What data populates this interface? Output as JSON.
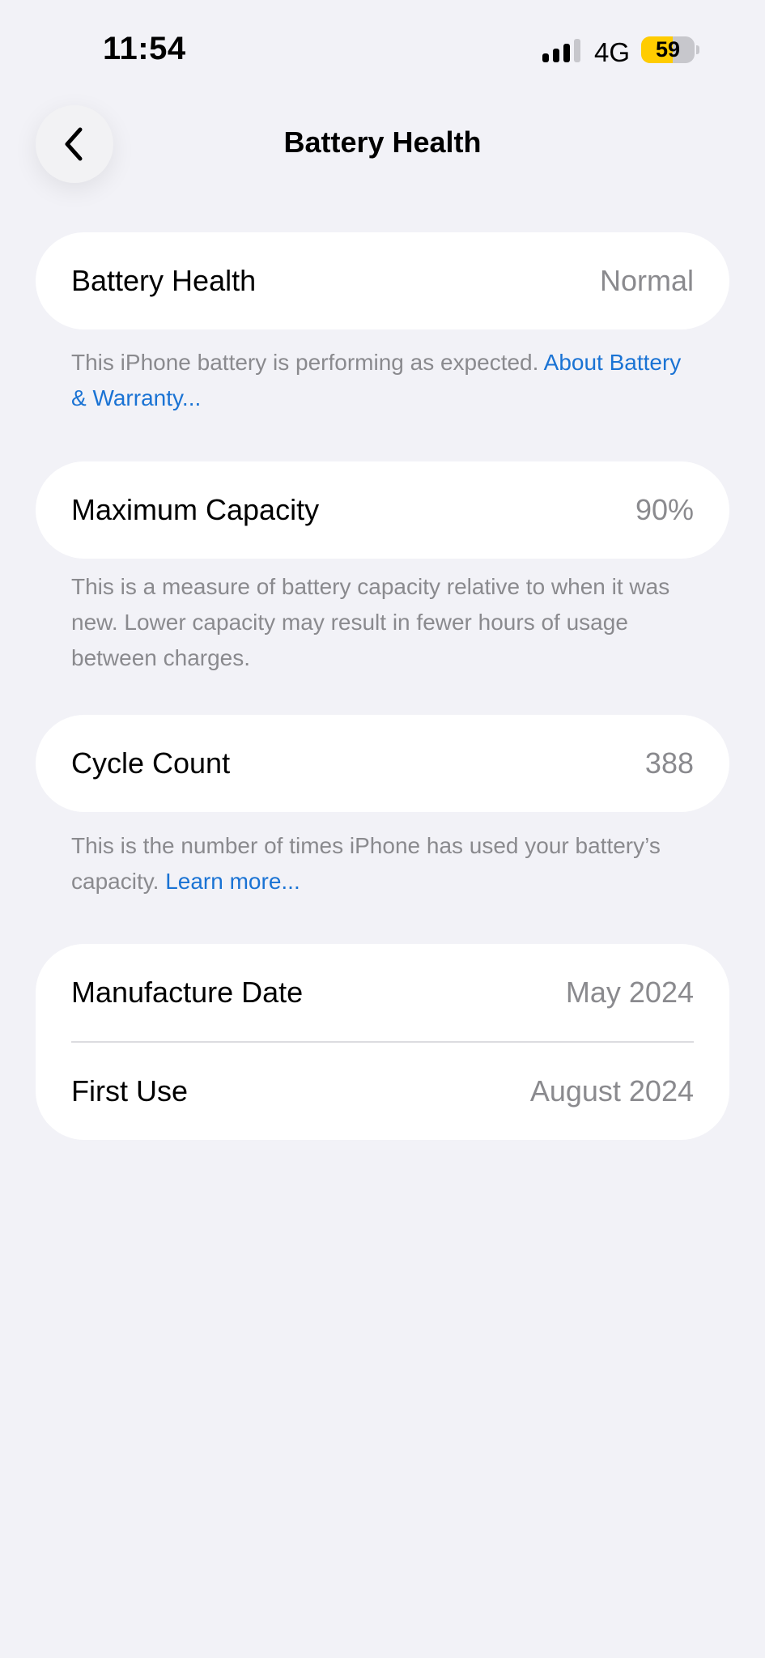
{
  "status_bar": {
    "time": "11:54",
    "network": "4G",
    "battery_level": "59",
    "battery_fraction": 0.59
  },
  "nav": {
    "back_icon": "chevron-left-icon",
    "title": "Battery Health"
  },
  "battery_health": {
    "label": "Battery Health",
    "value": "Normal",
    "footnote": "This iPhone battery is performing as expected. ",
    "footnote_link": "About Battery & Warranty..."
  },
  "maximum_capacity": {
    "label": "Maximum Capacity",
    "value": "90%",
    "footnote": "This is a measure of battery capacity relative to when it was new. Lower capacity may result in fewer hours of usage between charges."
  },
  "cycle_count": {
    "label": "Cycle Count",
    "value": "388",
    "footnote": "This is the number of times iPhone has used your battery’s capacity. ",
    "footnote_link": "Learn more..."
  },
  "dates": {
    "manufacture_label": "Manufacture Date",
    "manufacture_value": "May 2024",
    "first_use_label": "First Use",
    "first_use_value": "August 2024"
  },
  "colors": {
    "background": "#f2f2f7",
    "link": "#1a73d4",
    "battery_fill": "#ffcc00"
  }
}
